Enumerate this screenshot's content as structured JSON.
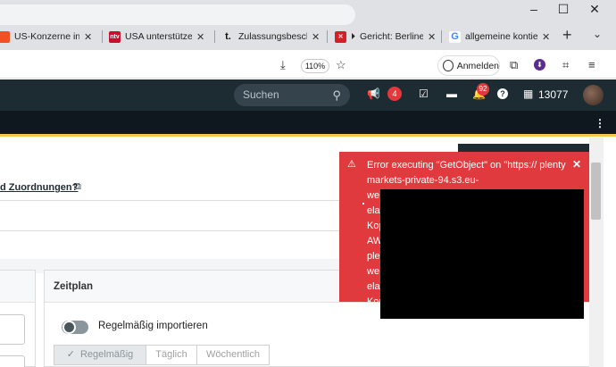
{
  "browser": {
    "tabs": [
      {
        "title": "US-Konzerne in Euro",
        "favicon": "ms-favicon",
        "color": "#ffffff"
      },
      {
        "title": "USA unterstützen Da",
        "favicon": "ntv-favicon",
        "color": "#c8102e"
      },
      {
        "title": "Zulassungsbeschein",
        "favicon": "t-favicon",
        "color": "#ffffff"
      },
      {
        "title": "Gericht: Berliner",
        "favicon": "tagesspiegel-favicon",
        "color": "#d32027",
        "playing": true
      },
      {
        "title": "allgemeine kontierur",
        "favicon": "google-favicon",
        "color": "#4285f4"
      }
    ],
    "zoom": "110%",
    "signin_label": "Anmelden"
  },
  "header": {
    "search_placeholder": "Suchen",
    "notifications_badge": "4",
    "messages_badge": "92",
    "cart_count": "13077"
  },
  "content": {
    "question_link": "d Zuordnungen?",
    "schedule_title": "Zeitplan",
    "import_toggle_label": "Regelmäßig importieren",
    "segments": [
      "Regelmäßig",
      "Täglich",
      "Wöchentlich"
    ],
    "active_segment": "Regelmäßig"
  },
  "toast": {
    "message": "Error executing \"GetObject\" on \"https:// plentymarkets-private-94.s3.eu-",
    "partial_lines": [
      "we",
      "ela",
      "Kop",
      "AW",
      "ple",
      "we",
      "ela",
      "Kop"
    ],
    "color": "#e03a3e"
  },
  "colors": {
    "header_bg": "#1d2b33",
    "accent_yellow": "#f2c94c",
    "badge_red": "#e5383b"
  }
}
